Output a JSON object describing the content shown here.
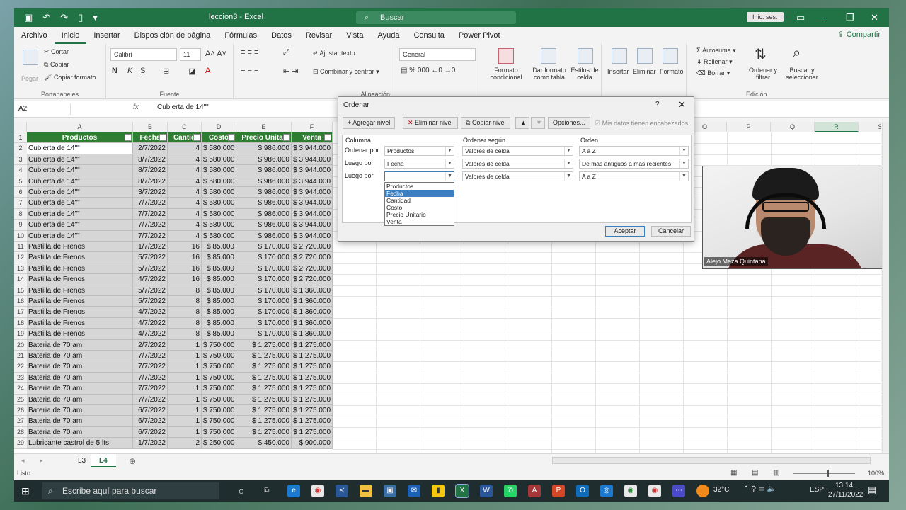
{
  "window": {
    "doc_title": "leccion3  -  Excel",
    "search_placeholder": "Buscar",
    "signin_label": "Inic. ses."
  },
  "menu": {
    "items": [
      "Archivo",
      "Inicio",
      "Insertar",
      "Disposición de página",
      "Fórmulas",
      "Datos",
      "Revisar",
      "Vista",
      "Ayuda",
      "Consulta",
      "Power Pivot"
    ],
    "share_label": "Compartir"
  },
  "ribbon": {
    "paste": "Pegar",
    "cut": "Cortar",
    "copy": "Copiar",
    "format_painter": "Copiar formato",
    "clipboard_group": "Portapapeles",
    "font_name": "Calibri",
    "font_size": "11",
    "font_group": "Fuente",
    "wrap_text": "Ajustar texto",
    "merge_center": "Combinar y centrar",
    "align_group": "Alineación",
    "number_format": "General",
    "cond_format": "Formato condicional",
    "table_format": "Dar formato como tabla",
    "cell_styles": "Estilos de celda",
    "insert": "Insertar",
    "delete": "Eliminar",
    "format": "Formato",
    "autosum": "Autosuma",
    "fill": "Rellenar",
    "clear": "Borrar",
    "sort_filter": "Ordenar y filtrar",
    "find_select": "Buscar y seleccionar",
    "edit_group": "Edición"
  },
  "formula_bar": {
    "cell_ref": "A2",
    "fx": "fx",
    "value": "Cubierta de 14\"\""
  },
  "sheet": {
    "columns_left": [
      "A",
      "B",
      "C",
      "D",
      "E",
      "F"
    ],
    "columns_right": [
      "O",
      "P",
      "Q",
      "R",
      "S"
    ],
    "header_row": [
      "Productos",
      "Fecha",
      "Cantid",
      "Costo",
      "Precio Unitar",
      "Venta"
    ],
    "rows": [
      [
        "Cubierta de 14\"\"",
        "2/7/2022",
        "4",
        "$ 580.000",
        "$ 986.000",
        "$ 3.944.000"
      ],
      [
        "Cubierta de 14\"\"",
        "8/7/2022",
        "4",
        "$ 580.000",
        "$ 986.000",
        "$ 3.944.000"
      ],
      [
        "Cubierta de 14\"\"",
        "8/7/2022",
        "4",
        "$ 580.000",
        "$ 986.000",
        "$ 3.944.000"
      ],
      [
        "Cubierta de 14\"\"",
        "8/7/2022",
        "4",
        "$ 580.000",
        "$ 986.000",
        "$ 3.944.000"
      ],
      [
        "Cubierta de 14\"\"",
        "3/7/2022",
        "4",
        "$ 580.000",
        "$ 986.000",
        "$ 3.944.000"
      ],
      [
        "Cubierta de 14\"\"",
        "7/7/2022",
        "4",
        "$ 580.000",
        "$ 986.000",
        "$ 3.944.000"
      ],
      [
        "Cubierta de 14\"\"",
        "7/7/2022",
        "4",
        "$ 580.000",
        "$ 986.000",
        "$ 3.944.000"
      ],
      [
        "Cubierta de 14\"\"",
        "7/7/2022",
        "4",
        "$ 580.000",
        "$ 986.000",
        "$ 3.944.000"
      ],
      [
        "Cubierta de 14\"\"",
        "7/7/2022",
        "4",
        "$ 580.000",
        "$ 986.000",
        "$ 3.944.000"
      ],
      [
        "Pastilla de Frenos",
        "1/7/2022",
        "16",
        "$ 85.000",
        "$ 170.000",
        "$ 2.720.000"
      ],
      [
        "Pastilla de Frenos",
        "5/7/2022",
        "16",
        "$ 85.000",
        "$ 170.000",
        "$ 2.720.000"
      ],
      [
        "Pastilla de Frenos",
        "5/7/2022",
        "16",
        "$ 85.000",
        "$ 170.000",
        "$ 2.720.000"
      ],
      [
        "Pastilla de Frenos",
        "4/7/2022",
        "16",
        "$ 85.000",
        "$ 170.000",
        "$ 2.720.000"
      ],
      [
        "Pastilla de Frenos",
        "5/7/2022",
        "8",
        "$ 85.000",
        "$ 170.000",
        "$ 1.360.000"
      ],
      [
        "Pastilla de Frenos",
        "5/7/2022",
        "8",
        "$ 85.000",
        "$ 170.000",
        "$ 1.360.000"
      ],
      [
        "Pastilla de Frenos",
        "4/7/2022",
        "8",
        "$ 85.000",
        "$ 170.000",
        "$ 1.360.000"
      ],
      [
        "Pastilla de Frenos",
        "4/7/2022",
        "8",
        "$ 85.000",
        "$ 170.000",
        "$ 1.360.000"
      ],
      [
        "Pastilla de Frenos",
        "4/7/2022",
        "8",
        "$ 85.000",
        "$ 170.000",
        "$ 1.360.000"
      ],
      [
        "Bateria de 70 am",
        "2/7/2022",
        "1",
        "$ 750.000",
        "$ 1.275.000",
        "$ 1.275.000"
      ],
      [
        "Bateria de 70 am",
        "7/7/2022",
        "1",
        "$ 750.000",
        "$ 1.275.000",
        "$ 1.275.000"
      ],
      [
        "Bateria de 70 am",
        "7/7/2022",
        "1",
        "$ 750.000",
        "$ 1.275.000",
        "$ 1.275.000"
      ],
      [
        "Bateria de 70 am",
        "7/7/2022",
        "1",
        "$ 750.000",
        "$ 1.275.000",
        "$ 1.275.000"
      ],
      [
        "Bateria de 70 am",
        "7/7/2022",
        "1",
        "$ 750.000",
        "$ 1.275.000",
        "$ 1.275.000"
      ],
      [
        "Bateria de 70 am",
        "7/7/2022",
        "1",
        "$ 750.000",
        "$ 1.275.000",
        "$ 1.275.000"
      ],
      [
        "Bateria de 70 am",
        "6/7/2022",
        "1",
        "$ 750.000",
        "$ 1.275.000",
        "$ 1.275.000"
      ],
      [
        "Bateria de 70 am",
        "6/7/2022",
        "1",
        "$ 750.000",
        "$ 1.275.000",
        "$ 1.275.000"
      ],
      [
        "Bateria de 70 am",
        "6/7/2022",
        "1",
        "$ 750.000",
        "$ 1.275.000",
        "$ 1.275.000"
      ],
      [
        "Lubricante castrol de 5  lts",
        "1/7/2022",
        "2",
        "$ 250.000",
        "$ 450.000",
        "$ 900.000"
      ]
    ]
  },
  "sheet_tabs": [
    "L3",
    "L4"
  ],
  "status": {
    "ready": "Listo",
    "zoom": "100%"
  },
  "dialog": {
    "title": "Ordenar",
    "help": "?",
    "add_level": "Agregar nivel",
    "delete_level": "Eliminar nivel",
    "copy_level": "Copiar nivel",
    "options": "Opciones...",
    "headers_checkbox": "Mis datos tienen encabezados",
    "col_header_column": "Columna",
    "col_header_sort_on": "Ordenar según",
    "col_header_order": "Orden",
    "levels": [
      {
        "label": "Ordenar por",
        "column": "Productos",
        "sort_on": "Valores de celda",
        "order": "A a Z"
      },
      {
        "label": "Luego por",
        "column": "Fecha",
        "sort_on": "Valores de celda",
        "order": "De más antiguos a más recientes"
      },
      {
        "label": "Luego por",
        "column": "",
        "sort_on": "Valores de celda",
        "order": "A a Z"
      }
    ],
    "dropdown_options": [
      "Productos",
      "Fecha",
      "Cantidad",
      "Costo",
      "Precio Unitario",
      "Venta"
    ],
    "accept": "Aceptar",
    "cancel": "Cancelar"
  },
  "webcam": {
    "name": "Alejo Meza Quintana"
  },
  "taskbar": {
    "search_placeholder": "Escribe aquí para buscar",
    "weather": "32°C",
    "lang": "ESP",
    "time": "13:14",
    "date": "27/11/2022"
  },
  "colors": {
    "excel_green": "#217346",
    "header_green": "#2e7d32",
    "dialog_blue": "#3c7fc1"
  }
}
